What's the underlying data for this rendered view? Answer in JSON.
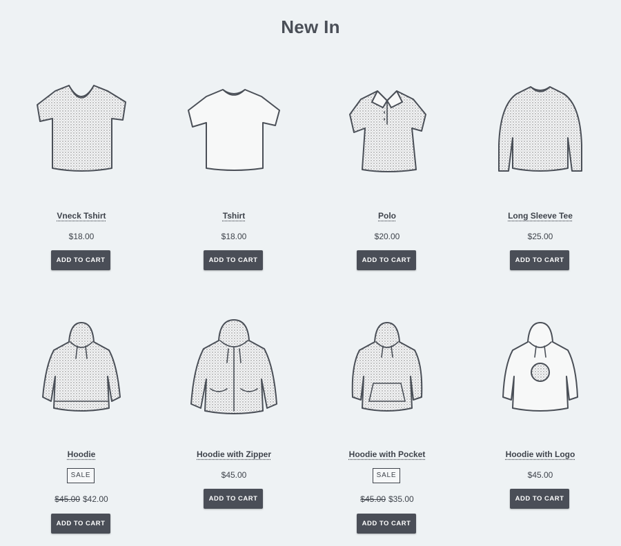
{
  "page": {
    "title": "New In"
  },
  "products": [
    {
      "name": "Vneck Tshirt",
      "price": "$18.00",
      "button": "ADD TO CART"
    },
    {
      "name": "Tshirt",
      "price": "$18.00",
      "button": "ADD TO CART"
    },
    {
      "name": "Polo",
      "price": "$20.00",
      "button": "ADD TO CART"
    },
    {
      "name": "Long Sleeve Tee",
      "price": "$25.00",
      "button": "ADD TO CART"
    },
    {
      "name": "Hoodie",
      "badge": "SALE",
      "old_price": "$45.00",
      "price": "$42.00",
      "button": "ADD TO CART"
    },
    {
      "name": "Hoodie with Zipper",
      "price": "$45.00",
      "button": "ADD TO CART"
    },
    {
      "name": "Hoodie with Pocket",
      "badge": "SALE",
      "old_price": "$45.00",
      "price": "$35.00",
      "button": "ADD TO CART"
    },
    {
      "name": "Hoodie with Logo",
      "price": "$45.00",
      "button": "ADD TO CART"
    }
  ]
}
